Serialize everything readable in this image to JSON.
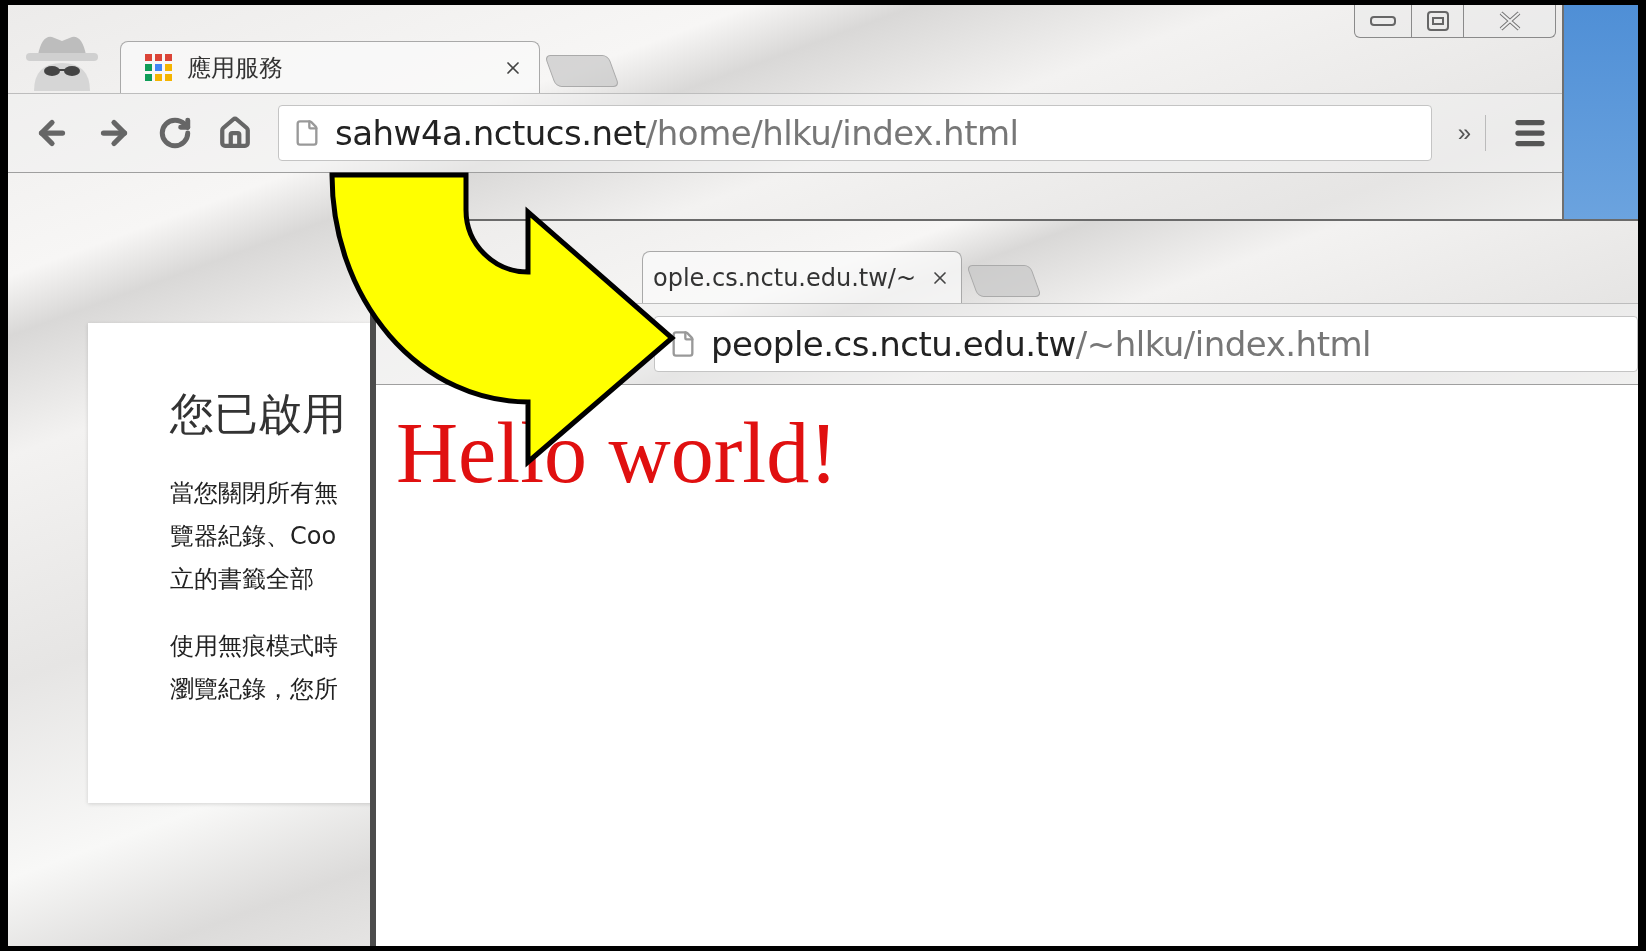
{
  "back_window": {
    "tabs": [
      {
        "title": "應用服務",
        "selected": true
      }
    ],
    "address": {
      "host": "sahw4a.nctucs.net",
      "path": "/home/hlku/index.html"
    },
    "overflow_label": "»",
    "card": {
      "title": "您已啟用",
      "paragraphs": [
        [
          "當您關閉所有無",
          "覽器紀錄、Coo",
          "立的書籤全部"
        ],
        [
          "使用無痕模式時",
          "瀏覽紀錄，您所"
        ]
      ]
    }
  },
  "front_window": {
    "tabs": [
      {
        "title": "ople.cs.nctu.edu.tw/~",
        "selected": true
      }
    ],
    "address": {
      "host": "people.cs.nctu.edu.tw",
      "path": "/~hlku/index.html"
    },
    "page": {
      "heading": "Hello world!"
    }
  }
}
